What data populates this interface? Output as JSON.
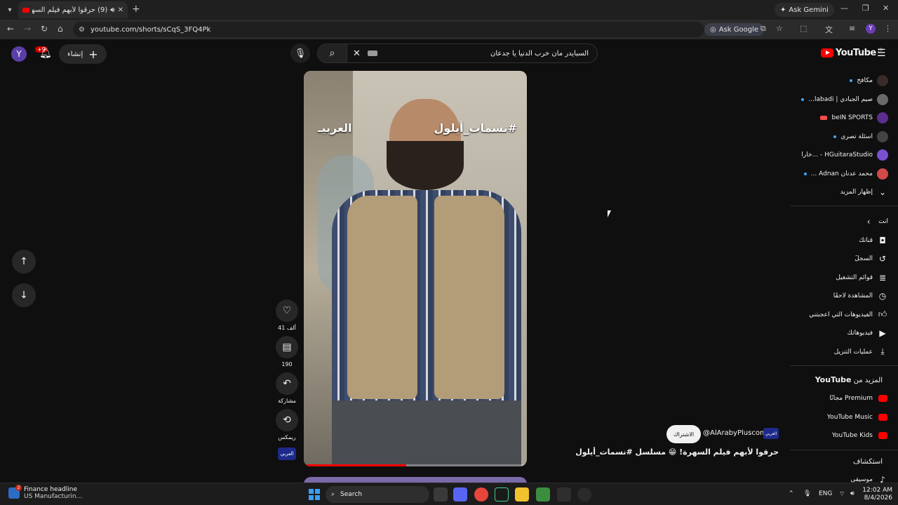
{
  "browser": {
    "tab_title": "(9) حرقوا لأبهم فيلم السهرة! 😁",
    "ask_gemini": "Ask Gemini",
    "url": "youtube.com/shorts/sCqS_3FQ4Pk",
    "ask_google": "Ask Google",
    "profile_initial": "Y"
  },
  "masthead": {
    "user_initial": "Y",
    "notif_badge": "+9",
    "create_label": "إنشاء",
    "search_query": "السبايدر مان خرب الدنيا يا جدعان",
    "logo_word": "YouTube",
    "logo_region": "JO"
  },
  "video": {
    "hashtag_overlay": "#نسمات_أيلول",
    "brand_overlay": "العربيـ",
    "progress_fraction": 0.46,
    "likes": "41 ألف",
    "comments": "190",
    "share": "مشاركة",
    "remix": "ريمكس",
    "channel_logo_text": "العربي",
    "subscribe": "الاشتراك",
    "channel_handle": "@AlArabyPluscom",
    "title": "حرقوا لأبهم فيلم السهرة! 😁 مسلسل #نسمات_أيلول"
  },
  "sidebar": {
    "subscriptions": [
      {
        "label": "مكافح",
        "indicator": "dot",
        "color": "#3b2a2a"
      },
      {
        "label": "صيم الجبادي | labadi...",
        "indicator": "dot",
        "color": "#6a6a6a"
      },
      {
        "label": "beIN SPORTS",
        "indicator": "live",
        "color": "#5b2d8e"
      },
      {
        "label": "أسئلة تصري",
        "indicator": "dot",
        "color": "#444444"
      },
      {
        "label": "HGuitaraStudio - ...خارا",
        "indicator": "none",
        "color": "#7a4fd0"
      },
      {
        "label": "محمد عدنان Adnan ...",
        "indicator": "dot",
        "color": "#d04a4a"
      }
    ],
    "show_more": "إظهار المزيد",
    "you_header": "أنت",
    "you_items": [
      {
        "label": "قناتك",
        "icon": "person-box-icon"
      },
      {
        "label": "السجلّ",
        "icon": "history-icon"
      },
      {
        "label": "قوائم التشغيل",
        "icon": "playlist-icon"
      },
      {
        "label": "المشاهدة لاحقًا",
        "icon": "clock-icon"
      },
      {
        "label": "الفيديوهات التي أعجبتني",
        "icon": "thumb-up-icon"
      },
      {
        "label": "فيديوهاتك",
        "icon": "video-play-icon"
      },
      {
        "label": "عمليات التنزيل",
        "icon": "download-icon"
      }
    ],
    "more_header_prefix": "المزيد من",
    "more_header_brand": "YouTube",
    "more_items": [
      {
        "label": "Premium مجانًا",
        "color": "#ff0000"
      },
      {
        "label": "YouTube Music",
        "color": "#ff0000"
      },
      {
        "label": "YouTube Kids",
        "color": "#ff0000"
      }
    ],
    "explore_header": "استكشاف",
    "explore_items": [
      {
        "label": "موسيقى",
        "icon": "music-note-icon"
      }
    ]
  },
  "taskbar": {
    "news_title": "Finance headline",
    "news_sub": "US Manufacturin...",
    "news_badge": "2",
    "search_label": "Search",
    "lang": "ENG",
    "time": "12:02 AM",
    "date": "8/4/2026"
  },
  "colors": {
    "accent": "#ff0000",
    "background": "#0f0f0f"
  }
}
